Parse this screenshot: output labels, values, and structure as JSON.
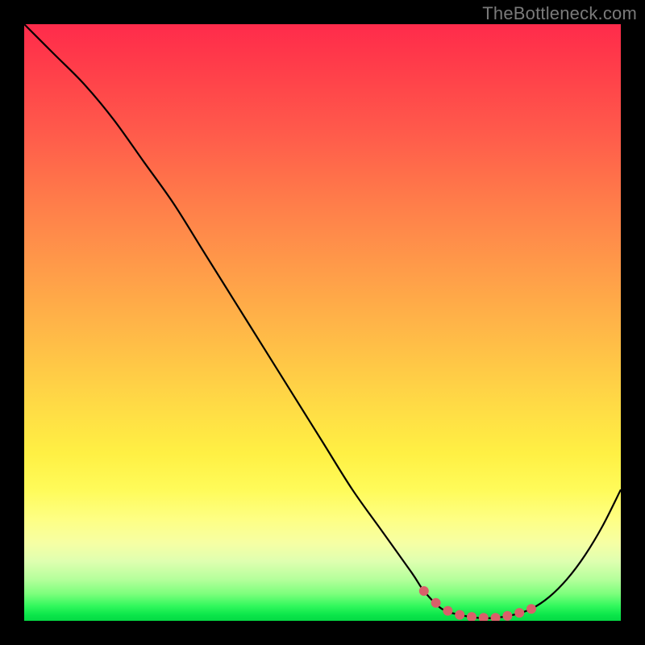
{
  "watermark": "TheBottleneck.com",
  "chart_data": {
    "type": "line",
    "title": "",
    "xlabel": "",
    "ylabel": "",
    "xlim": [
      0,
      100
    ],
    "ylim": [
      0,
      100
    ],
    "series": [
      {
        "name": "bottleneck-curve",
        "x": [
          0,
          5,
          10,
          15,
          20,
          25,
          30,
          35,
          40,
          45,
          50,
          55,
          60,
          65,
          67,
          70,
          73,
          76,
          79,
          82,
          85,
          88,
          91,
          94,
          97,
          100
        ],
        "values": [
          100,
          95,
          90,
          84,
          77,
          70,
          62,
          54,
          46,
          38,
          30,
          22,
          15,
          8,
          5,
          2,
          1,
          0.5,
          0.5,
          1,
          2,
          4,
          7,
          11,
          16,
          22
        ]
      }
    ],
    "optimal_zone": {
      "x_start": 67,
      "x_end": 85
    },
    "marker_points_x": [
      67,
      69,
      71,
      73,
      75,
      77,
      79,
      81,
      83,
      85
    ]
  }
}
